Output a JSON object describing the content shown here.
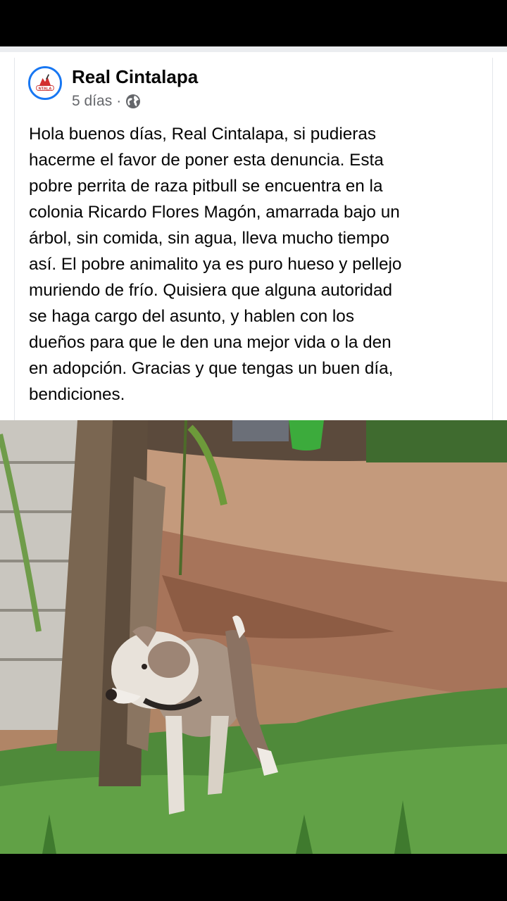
{
  "post": {
    "page_name": "Real Cintalapa",
    "timestamp": "5 días",
    "separator": "·",
    "audience_icon": "globe-icon",
    "avatar_logo_text": "NTALA",
    "text": "Hola buenos días, Real Cintalapa, si pudieras\nhacerme el favor de poner esta denuncia. Esta\npobre perrita de raza pitbull se encuentra en la\ncolonia Ricardo Flores Magón, amarrada bajo un\nárbol, sin comida, sin agua, lleva mucho tiempo\nasí. El pobre animalito ya es puro hueso y pellejo\nmuriendo de frío. Quisiera que alguna autoridad\nse haga cargo del asunto, y hablen con los\ndueños para que le den una mejor vida o la den\nen adopción. Gracias y que tengas un buen día,\nbendiciones."
  },
  "colors": {
    "brand_blue": "#1877f2",
    "text_primary": "#050505",
    "text_secondary": "#65676b"
  }
}
